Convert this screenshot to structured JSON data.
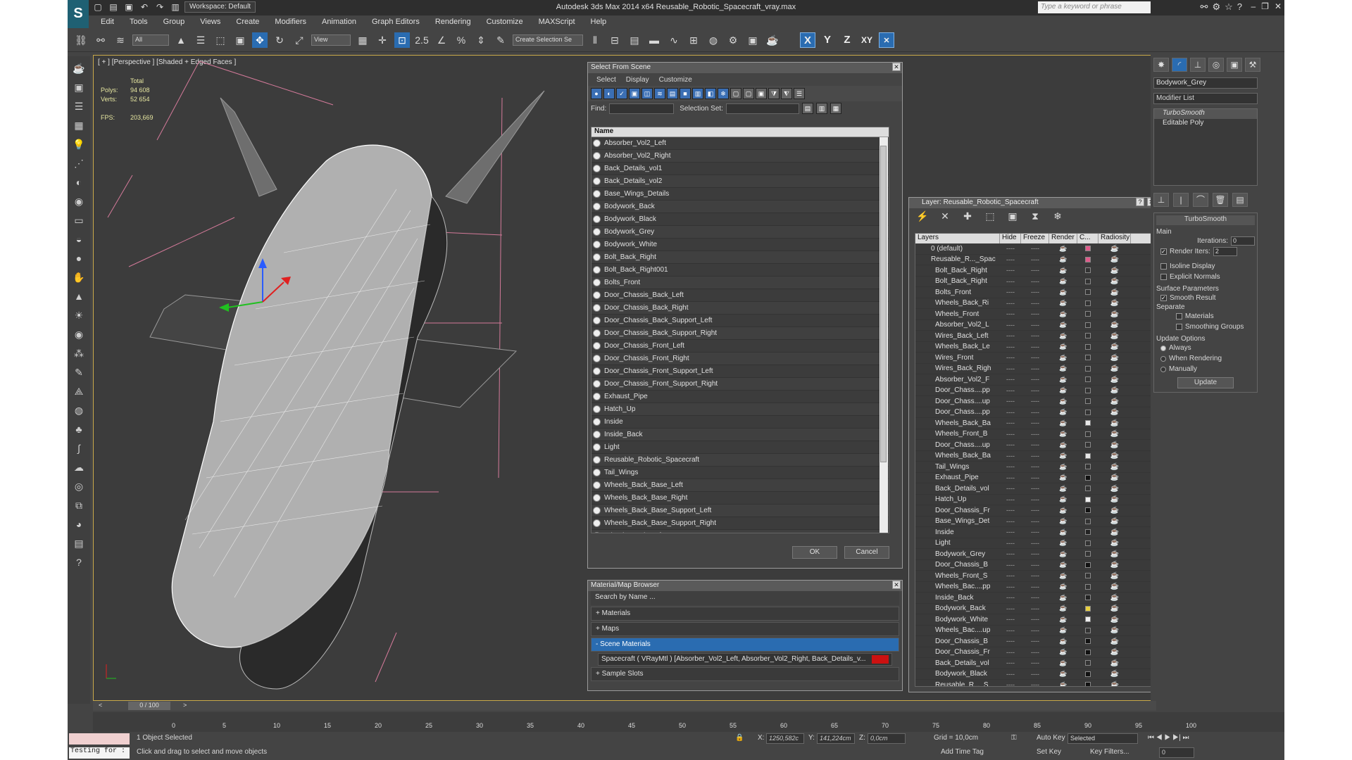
{
  "titlebar": {
    "title": "Autodesk 3ds Max  2014 x64      Reusable_Robotic_Spacecraft_vray.max",
    "workspace": "Workspace: Default",
    "search_placeholder": "Type a keyword or phrase"
  },
  "menubar": [
    "Edit",
    "Tools",
    "Group",
    "Views",
    "Create",
    "Modifiers",
    "Animation",
    "Graph Editors",
    "Rendering",
    "Customize",
    "MAXScript",
    "Help"
  ],
  "toolbar": {
    "filter": "All",
    "view": "View",
    "selection_set": "Create Selection Se",
    "snap_label": "2.5",
    "axes": [
      "X",
      "Y",
      "Z",
      "XY"
    ]
  },
  "viewport": {
    "label": "[ + ] [Perspective ] [Shaded + Edged Faces ]",
    "stats": {
      "total_label": "Total",
      "polys_label": "Polys:",
      "polys": "94 608",
      "verts_label": "Verts:",
      "verts": "52 654",
      "fps_label": "FPS:",
      "fps": "203,669"
    }
  },
  "select_from_scene": {
    "title": "Select From Scene",
    "menu": [
      "Select",
      "Display",
      "Customize"
    ],
    "find_label": "Find:",
    "selection_set_label": "Selection Set:",
    "column_name": "Name",
    "objects": [
      "Absorber_Vol2_Left",
      "Absorber_Vol2_Right",
      "Back_Details_vol1",
      "Back_Details_vol2",
      "Base_Wings_Details",
      "Bodywork_Back",
      "Bodywork_Black",
      "Bodywork_Grey",
      "Bodywork_White",
      "Bolt_Back_Right",
      "Bolt_Back_Right001",
      "Bolts_Front",
      "Door_Chassis_Back_Left",
      "Door_Chassis_Back_Right",
      "Door_Chassis_Back_Support_Left",
      "Door_Chassis_Back_Support_Right",
      "Door_Chassis_Front_Left",
      "Door_Chassis_Front_Right",
      "Door_Chassis_Front_Support_Left",
      "Door_Chassis_Front_Support_Right",
      "Exhaust_Pipe",
      "Hatch_Up",
      "Inside",
      "Inside_Back",
      "Light",
      "Reusable_Robotic_Spacecraft",
      "Tail_Wings",
      "Wheels_Back_Base_Left",
      "Wheels_Back_Base_Right",
      "Wheels_Back_Base_Support_Left",
      "Wheels_Back_Base_Support_Right",
      "Wheels_Back_Left"
    ],
    "ok": "OK",
    "cancel": "Cancel"
  },
  "material_browser": {
    "title": "Material/Map Browser",
    "search_placeholder": "Search by Name ...",
    "groups": [
      "+ Materials",
      "+ Maps",
      "- Scene Materials"
    ],
    "scene_material": "Spacecraft ( VRayMtl ) [Absorber_Vol2_Left, Absorber_Vol2_Right, Back_Details_v...",
    "sample_slots": "+ Sample Slots"
  },
  "layer_dialog": {
    "title": "Layer: Reusable_Robotic_Spacecraft",
    "columns": [
      "Layers",
      "Hide",
      "Freeze",
      "Render",
      "C...",
      "Radiosity"
    ],
    "layers": [
      {
        "name": "0 (default)",
        "color": "#e05a8a",
        "top": true
      },
      {
        "name": "Reusable_R..._Spac",
        "color": "#e05a8a",
        "top": true
      },
      {
        "name": "Bolt_Back_Right",
        "color": "#333333"
      },
      {
        "name": "Bolt_Back_Right",
        "color": "#333333"
      },
      {
        "name": "Bolts_Front",
        "color": "#333333"
      },
      {
        "name": "Wheels_Back_Ri",
        "color": "#333333"
      },
      {
        "name": "Wheels_Front",
        "color": "#333333"
      },
      {
        "name": "Absorber_Vol2_L",
        "color": "#333333"
      },
      {
        "name": "Wires_Back_Left",
        "color": "#333333"
      },
      {
        "name": "Wheels_Back_Le",
        "color": "#333333"
      },
      {
        "name": "Wires_Front",
        "color": "#333333"
      },
      {
        "name": "Wires_Back_Righ",
        "color": "#333333"
      },
      {
        "name": "Absorber_Vol2_F",
        "color": "#333333"
      },
      {
        "name": "Door_Chass....pp",
        "color": "#333333"
      },
      {
        "name": "Door_Chass....up",
        "color": "#333333"
      },
      {
        "name": "Door_Chass....pp",
        "color": "#333333"
      },
      {
        "name": "Wheels_Back_Ba",
        "color": "#e8e8e8"
      },
      {
        "name": "Wheels_Front_B",
        "color": "#333333"
      },
      {
        "name": "Door_Chass....up",
        "color": "#333333"
      },
      {
        "name": "Wheels_Back_Ba",
        "color": "#e8e8e8"
      },
      {
        "name": "Tail_Wings",
        "color": "#333333"
      },
      {
        "name": "Exhaust_Pipe",
        "color": "#111111"
      },
      {
        "name": "Back_Details_vol",
        "color": "#333333"
      },
      {
        "name": "Hatch_Up",
        "color": "#f0f0f0"
      },
      {
        "name": "Door_Chassis_Fr",
        "color": "#111111"
      },
      {
        "name": "Base_Wings_Det",
        "color": "#333333"
      },
      {
        "name": "Inside",
        "color": "#222222"
      },
      {
        "name": "Light",
        "color": "#333333"
      },
      {
        "name": "Bodywork_Grey",
        "color": "#333333"
      },
      {
        "name": "Door_Chassis_B",
        "color": "#111111"
      },
      {
        "name": "Wheels_Front_S",
        "color": "#333333"
      },
      {
        "name": "Wheels_Bac....pp",
        "color": "#333333"
      },
      {
        "name": "Inside_Back",
        "color": "#222222"
      },
      {
        "name": "Bodywork_Back",
        "color": "#e8d040"
      },
      {
        "name": "Bodywork_White",
        "color": "#f0f0f0"
      },
      {
        "name": "Wheels_Bac....up",
        "color": "#333333"
      },
      {
        "name": "Door_Chassis_B",
        "color": "#111111"
      },
      {
        "name": "Door_Chassis_Fr",
        "color": "#111111"
      },
      {
        "name": "Back_Details_vol",
        "color": "#333333"
      },
      {
        "name": "Bodywork_Black",
        "color": "#111111"
      },
      {
        "name": "Reusable_R..._S",
        "color": "#111111"
      }
    ]
  },
  "command_panel": {
    "object_name": "Bodywork_Grey",
    "modifier_list": "Modifier List",
    "stack": [
      "TurboSmooth",
      "Editable Poly"
    ],
    "turbosmooth": {
      "title": "TurboSmooth",
      "main": "Main",
      "iterations_label": "Iterations:",
      "iterations": "0",
      "render_iters_label": "Render Iters:",
      "render_iters": "2",
      "isoline": "Isoline Display",
      "explicit": "Explicit Normals",
      "surface": "Surface Parameters",
      "smooth_result": "Smooth Result",
      "separate": "Separate",
      "materials": "Materials",
      "smoothing_groups": "Smoothing Groups",
      "update_options": "Update Options",
      "always": "Always",
      "when_rendering": "When Rendering",
      "manually": "Manually",
      "update": "Update"
    }
  },
  "timeline": {
    "frame": "0 / 100",
    "ticks": [
      "0",
      "5",
      "10",
      "15",
      "20",
      "25",
      "30",
      "35",
      "40",
      "45",
      "50",
      "55",
      "60",
      "65",
      "70",
      "75",
      "80",
      "85",
      "90",
      "95",
      "100"
    ]
  },
  "status": {
    "maxscript": "Testing for :",
    "selected": "1 Object Selected",
    "prompt": "Click and drag to select and move objects",
    "x_label": "X:",
    "x": "1250,582c",
    "y_label": "Y:",
    "y": "141,224cm",
    "z_label": "Z:",
    "z": "0,0cm",
    "grid": "Grid = 10,0cm",
    "auto_key": "Auto Key",
    "key_mode": "Selected",
    "set_key": "Set Key",
    "key_filters": "Key Filters...",
    "add_time_tag": "Add Time Tag",
    "frame": "0"
  }
}
